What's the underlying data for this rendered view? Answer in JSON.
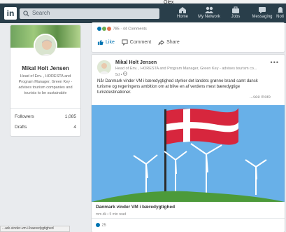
{
  "browser": {
    "tab_mark": "Olex"
  },
  "topbar": {
    "logo": "in",
    "search_placeholder": "Search",
    "nav": [
      {
        "label": "Home",
        "icon": "home-icon"
      },
      {
        "label": "My Network",
        "icon": "network-icon"
      },
      {
        "label": "Jobs",
        "icon": "jobs-icon"
      },
      {
        "label": "Messaging",
        "icon": "messaging-icon"
      },
      {
        "label": "Noti",
        "icon": "notifications-icon"
      }
    ]
  },
  "profile": {
    "name": "Mikal Holt Jensen",
    "headline": "Head of Env. , HORESTA and Program Manager, Green Key - advises tourism companies and tourists to be sustainable",
    "followers_label": "Followers",
    "followers_value": "1,085",
    "drafts_label": "Drafts",
    "drafts_value": "4"
  },
  "feed_top": {
    "reactions": "785 · 44 Comments",
    "like_label": "Like",
    "comment_label": "Comment",
    "share_label": "Share"
  },
  "post": {
    "author": "Mikal Holt Jensen",
    "headline": "Head of Env. , HORESTA and Program Manager, Green Key - advises tourism co...",
    "time": "5d •",
    "text": "Når Danmark vinder VM i bæredygtighed styrker det landets grønne brand samt dansk turisme og regeringens ambition om at blive en af verdens mest bæredygtige turistdestinationer.",
    "see_more": "...see more",
    "article_title": "Danmark vinder VM i bæredygtighed",
    "article_meta": "mm.dk • 5 min read",
    "likes": "25"
  },
  "status_bar": "...ark-vinder-vm-i-baeredygtighed",
  "colors": {
    "topbar": "#293e4a",
    "accent": "#0073b1",
    "sky": "#68b0e8",
    "flag_red": "#d7263d",
    "grass": "#4c9a3a"
  }
}
